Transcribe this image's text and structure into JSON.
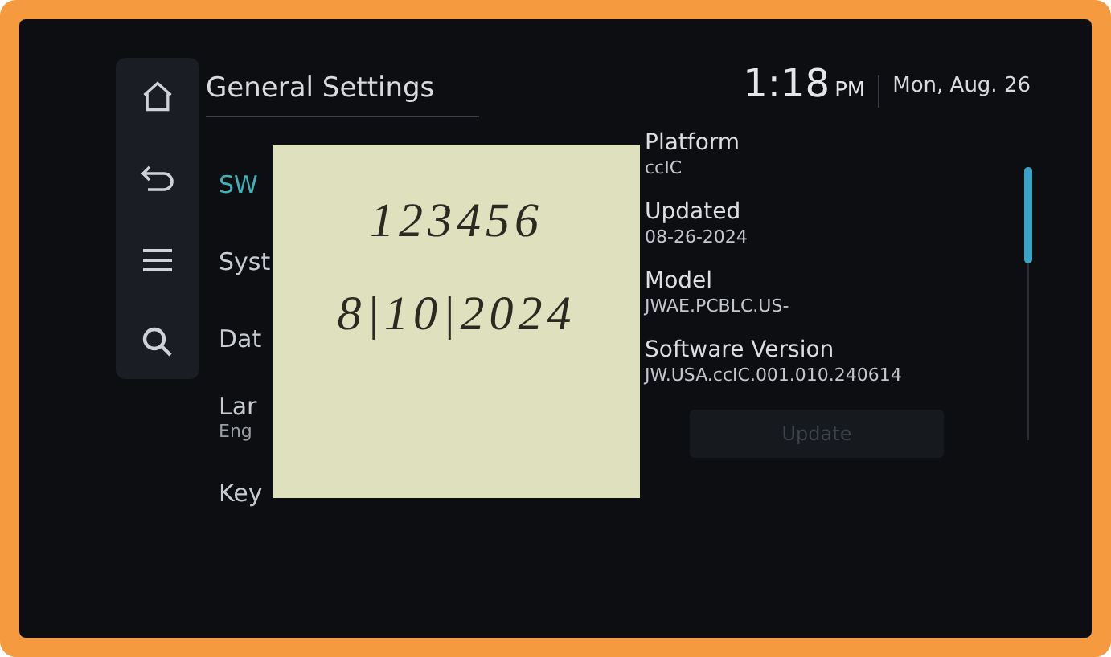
{
  "sidebar": {
    "icons": [
      {
        "kind": "home"
      },
      {
        "kind": "back"
      },
      {
        "kind": "menu"
      },
      {
        "kind": "search"
      }
    ]
  },
  "title": "General Settings",
  "menu": [
    {
      "label": "SW",
      "selected": true
    },
    {
      "label": "Syst",
      "selected": false
    },
    {
      "label": "Dat",
      "selected": false
    },
    {
      "label": "Lar",
      "sub": "Eng",
      "selected": false
    },
    {
      "label": "Key",
      "selected": false
    }
  ],
  "clock": {
    "time": "1:18",
    "ampm": "PM",
    "date": "Mon, Aug. 26"
  },
  "details": [
    {
      "label": "Platform",
      "value": "ccIC"
    },
    {
      "label": "Updated",
      "value": "08-26-2024"
    },
    {
      "label": "Model",
      "value": "JWAE.PCBLC.US-"
    },
    {
      "label": "Software Version",
      "value": "JW.USA.ccIC.001.010.240614"
    }
  ],
  "update_button": {
    "label": "Update",
    "disabled": true
  },
  "sticky_note": {
    "lines": [
      "123456",
      "8|10|2024"
    ]
  }
}
